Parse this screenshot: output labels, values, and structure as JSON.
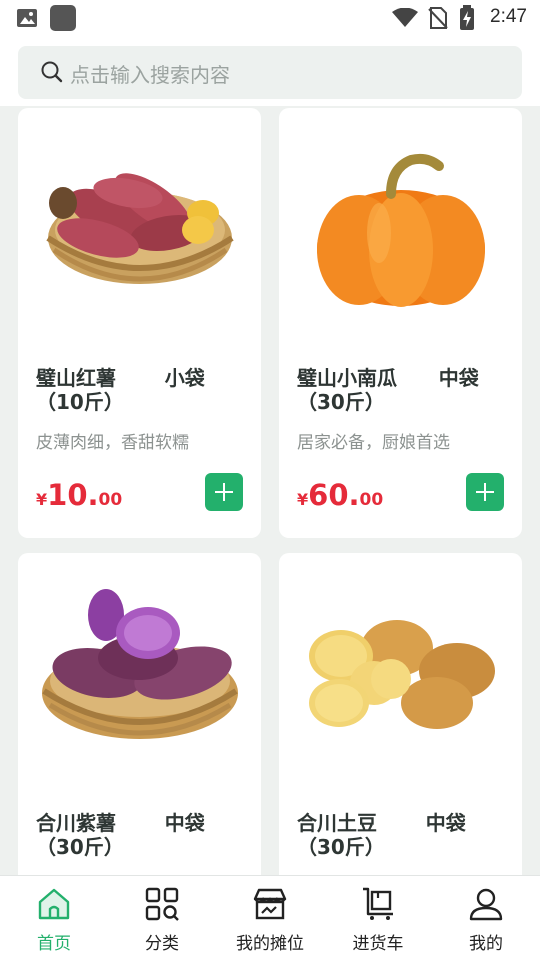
{
  "status_bar": {
    "time": "2:47"
  },
  "search": {
    "placeholder": "点击输入搜索内容"
  },
  "products": [
    {
      "title": "璧山红薯       小袋（10斤）",
      "desc": "皮薄肉细，香甜软糯",
      "price_symbol": "¥",
      "price_int": "10.",
      "price_dec": "00",
      "image": "sweet-potato-basket"
    },
    {
      "title": "璧山小南瓜      中袋（30斤）",
      "desc": "居家必备，厨娘首选",
      "price_symbol": "¥",
      "price_int": "60.",
      "price_dec": "00",
      "image": "pumpkin"
    },
    {
      "title": "合川紫薯       中袋（30斤）",
      "desc": "",
      "image": "purple-sweet-potato-basket"
    },
    {
      "title": "合川土豆       中袋（30斤）",
      "desc": "",
      "image": "potatoes"
    }
  ],
  "tabs": [
    {
      "label": "首页",
      "icon": "home-icon",
      "active": true
    },
    {
      "label": "分类",
      "icon": "category-icon"
    },
    {
      "label": "我的摊位",
      "icon": "stall-icon"
    },
    {
      "label": "进货车",
      "icon": "cart-icon"
    },
    {
      "label": "我的",
      "icon": "profile-icon"
    }
  ],
  "colors": {
    "accent": "#23b06c",
    "price": "#e52b3a",
    "background": "#eef1ef"
  }
}
